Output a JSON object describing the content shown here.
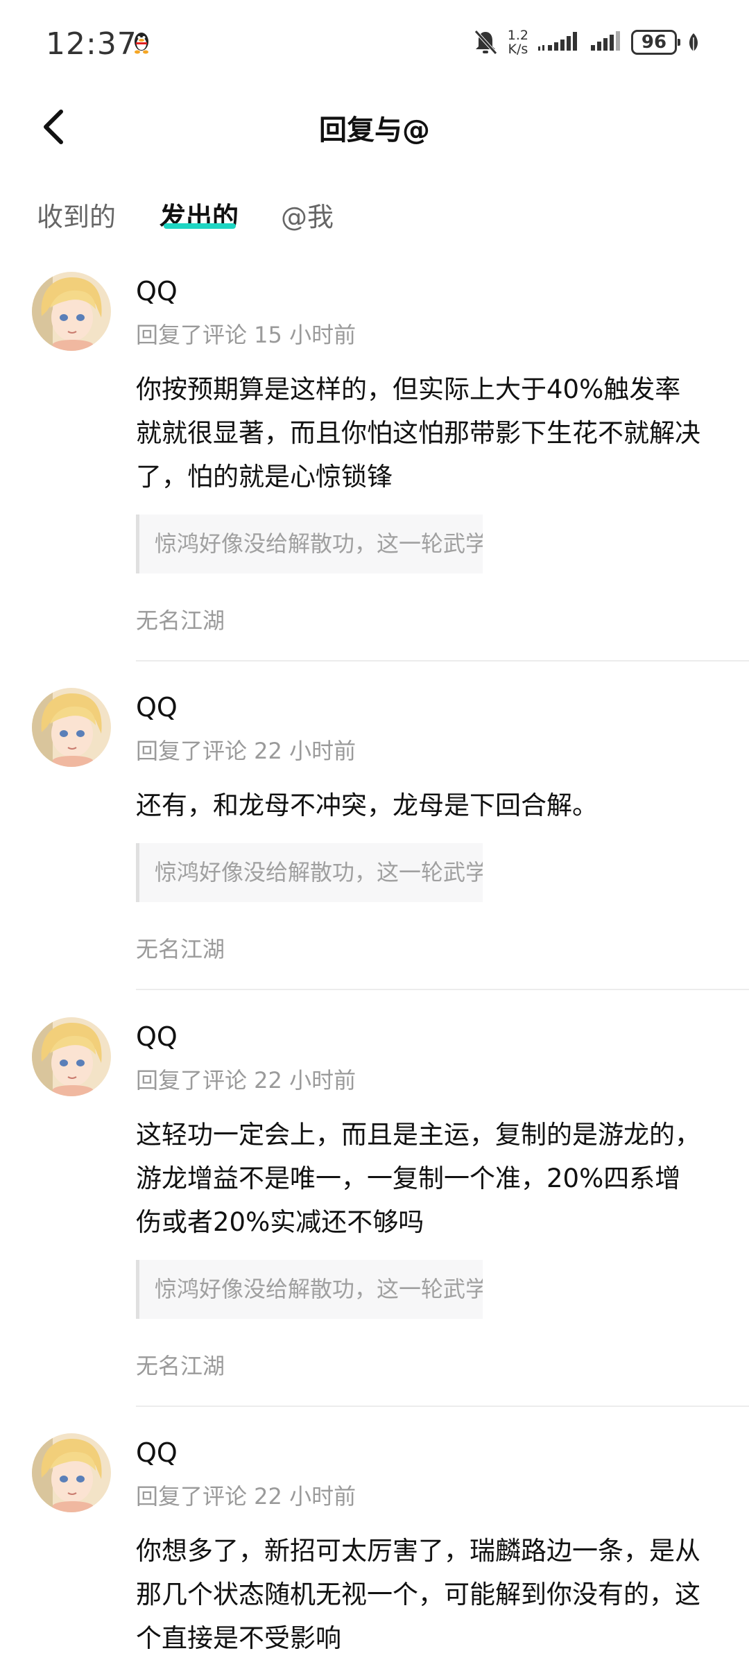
{
  "status_bar": {
    "time": "12:37",
    "net_speed_value": "1.2",
    "net_speed_unit": "K/s",
    "battery": "96"
  },
  "header": {
    "title": "回复与@"
  },
  "tabs": [
    {
      "label": "收到的",
      "active": false
    },
    {
      "label": "发出的",
      "active": true
    },
    {
      "label": "@我",
      "active": false
    }
  ],
  "colors": {
    "accent": "#1ed5c2",
    "meta_text": "#9a9a9a"
  },
  "items": [
    {
      "username": "QQ",
      "meta": "回复了评论 15 小时前",
      "content": "你按预期算是这样的，但实际上大于40%触发率就就很显著，而且你怕这怕那带影下生花不就解决了，怕的就是心惊锁锋",
      "quote": "惊鸿好像没给解散功，这一轮武学本质就是用...",
      "source": "无名江湖"
    },
    {
      "username": "QQ",
      "meta": "回复了评论 22 小时前",
      "content": "还有，和龙母不冲突，龙母是下回合解。",
      "quote": "惊鸿好像没给解散功，这一轮武学本质就是用...",
      "source": "无名江湖"
    },
    {
      "username": "QQ",
      "meta": "回复了评论 22 小时前",
      "content": "这轻功一定会上，而且是主运，复制的是游龙的，游龙增益不是唯一，一复制一个准，20%四系增伤或者20%实减还不够吗",
      "quote": "惊鸿好像没给解散功，这一轮武学本质就是用...",
      "source": "无名江湖"
    },
    {
      "username": "QQ",
      "meta": "回复了评论 22 小时前",
      "content": "你想多了，新招可太厉害了，瑞麟路边一条，是从那几个状态随机无视一个，可能解到你没有的，这个直接是不受影响"
    }
  ]
}
